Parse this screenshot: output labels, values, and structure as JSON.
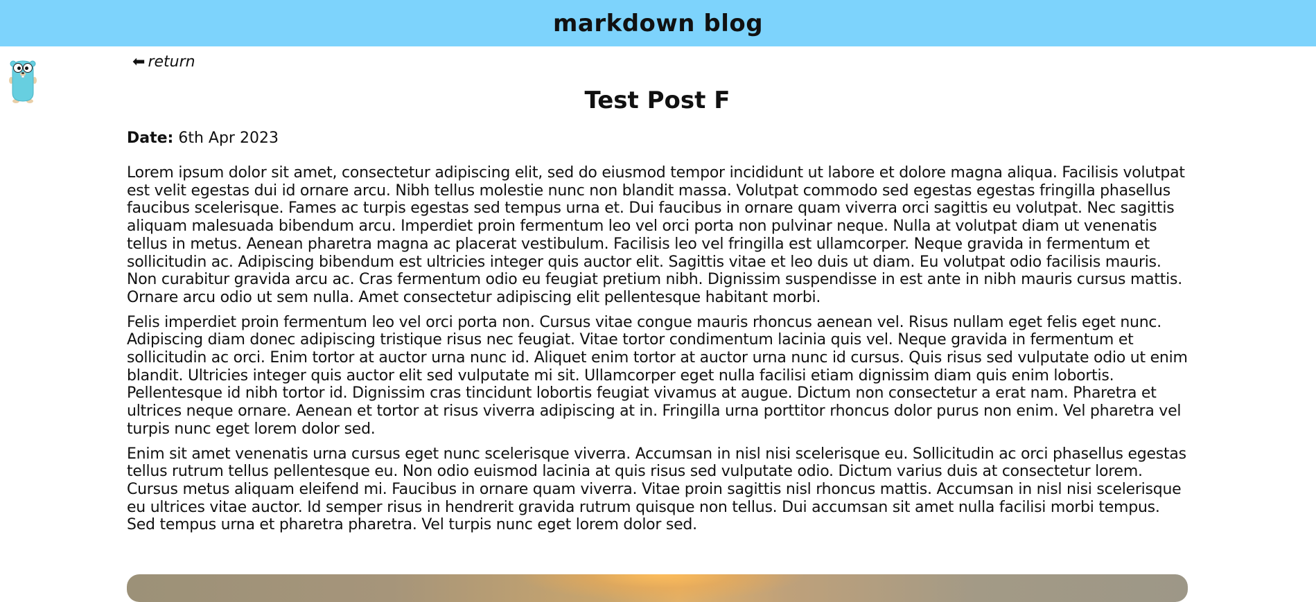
{
  "header": {
    "title": "markdown blog",
    "background": "#7dd3fc"
  },
  "mascot": {
    "icon": "gopher-icon"
  },
  "nav": {
    "return_arrow": "⬅",
    "return_label": "return"
  },
  "post": {
    "title": "Test Post F",
    "date_label": "Date:",
    "date_value": "6th Apr 2023",
    "paragraphs": [
      "Lorem ipsum dolor sit amet, consectetur adipiscing elit, sed do eiusmod tempor incididunt ut labore et dolore magna aliqua. Facilisis volutpat est velit egestas dui id ornare arcu. Nibh tellus molestie nunc non blandit massa. Volutpat commodo sed egestas egestas fringilla phasellus faucibus scelerisque. Fames ac turpis egestas sed tempus urna et. Dui faucibus in ornare quam viverra orci sagittis eu volutpat. Nec sagittis aliquam malesuada bibendum arcu. Imperdiet proin fermentum leo vel orci porta non pulvinar neque. Nulla at volutpat diam ut venenatis tellus in metus. Aenean pharetra magna ac placerat vestibulum. Facilisis leo vel fringilla est ullamcorper. Neque gravida in fermentum et sollicitudin ac. Adipiscing bibendum est ultricies integer quis auctor elit. Sagittis vitae et leo duis ut diam. Eu volutpat odio facilisis mauris. Non curabitur gravida arcu ac. Cras fermentum odio eu feugiat pretium nibh. Dignissim suspendisse in est ante in nibh mauris cursus mattis. Ornare arcu odio ut sem nulla. Amet consectetur adipiscing elit pellentesque habitant morbi.",
      "Felis imperdiet proin fermentum leo vel orci porta non. Cursus vitae congue mauris rhoncus aenean vel. Risus nullam eget felis eget nunc. Adipiscing diam donec adipiscing tristique risus nec feugiat. Vitae tortor condimentum lacinia quis vel. Neque gravida in fermentum et sollicitudin ac orci. Enim tortor at auctor urna nunc id. Aliquet enim tortor at auctor urna nunc id cursus. Quis risus sed vulputate odio ut enim blandit. Ultricies integer quis auctor elit sed vulputate mi sit. Ullamcorper eget nulla facilisi etiam dignissim diam quis enim lobortis. Pellentesque id nibh tortor id. Dignissim cras tincidunt lobortis feugiat vivamus at augue. Dictum non consectetur a erat nam. Pharetra et ultrices neque ornare. Aenean et tortor at risus viverra adipiscing at in. Fringilla urna porttitor rhoncus dolor purus non enim. Vel pharetra vel turpis nunc eget lorem dolor sed.",
      "Enim sit amet venenatis urna cursus eget nunc scelerisque viverra. Accumsan in nisl nisi scelerisque eu. Sollicitudin ac orci phasellus egestas tellus rutrum tellus pellentesque eu. Non odio euismod lacinia at quis risus sed vulputate odio. Dictum varius duis at consectetur lorem. Cursus metus aliquam eleifend mi. Faucibus in ornare quam viverra. Vitae proin sagittis nisl rhoncus mattis. Accumsan in nisl nisi scelerisque eu ultrices vitae auctor. Id semper risus in hendrerit gravida rutrum quisque non tellus. Dui accumsan sit amet nulla facilisi morbi tempus. Sed tempus urna et pharetra pharetra. Vel turpis nunc eget lorem dolor sed."
    ]
  }
}
